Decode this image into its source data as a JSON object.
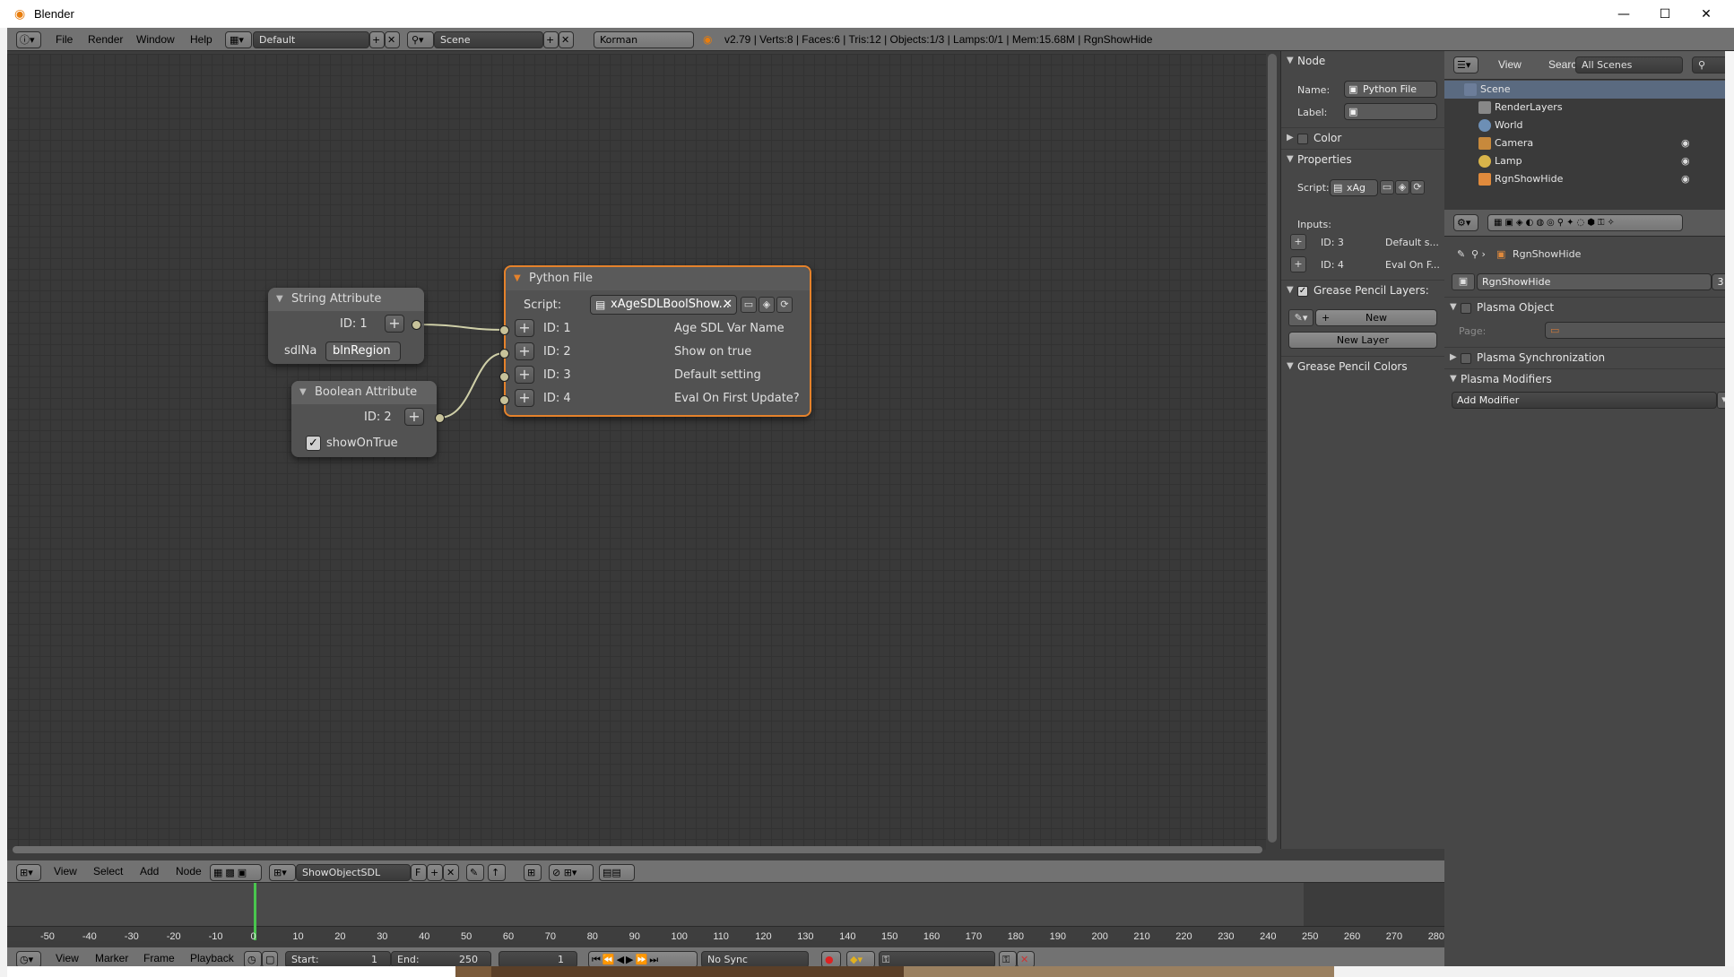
{
  "window": {
    "title": "Blender",
    "minimize": "—",
    "maximize": "☐",
    "close": "✕"
  },
  "top_header": {
    "menus": [
      "File",
      "Render",
      "Window",
      "Help"
    ],
    "layout": "Default",
    "scene": "Scene",
    "engine": "Korman",
    "info": "v2.79 | Verts:8 | Faces:6 | Tris:12 | Objects:1/3 | Lamps:0/1 | Mem:15.68M | RgnShowHide"
  },
  "nodes": {
    "string_attr": {
      "title": "String Attribute",
      "id_label": "ID: 1",
      "field_label": "sdlNa",
      "field_value": "blnRegion"
    },
    "bool_attr": {
      "title": "Boolean Attribute",
      "id_label": "ID: 2",
      "check_label": "showOnTrue"
    },
    "python_file": {
      "title": "Python File",
      "script_label": "Script:",
      "script_value": "xAgeSDLBoolShow...",
      "rows": [
        {
          "id": "ID: 1",
          "name": "Age SDL Var Name"
        },
        {
          "id": "ID: 2",
          "name": "Show on true"
        },
        {
          "id": "ID: 3",
          "name": "Default setting"
        },
        {
          "id": "ID: 4",
          "name": "Eval On First Update?"
        }
      ]
    }
  },
  "node_editor_header": {
    "menus": [
      "View",
      "Select",
      "Add",
      "Node"
    ],
    "tree_name": "ShowObjectSDL",
    "fake_user": "F"
  },
  "props_panel": {
    "node_section": "Node",
    "name_label": "Name:",
    "name_value": "Python File",
    "label_label": "Label:",
    "color_section": "Color",
    "properties_section": "Properties",
    "script_label": "Script:",
    "script_value": "xAg",
    "inputs_label": "Inputs:",
    "inputs": [
      {
        "id": "ID: 3",
        "value": "Default s..."
      },
      {
        "id": "ID: 4",
        "value": "Eval On F..."
      }
    ],
    "gp_layers_section": "Grease Pencil Layers:",
    "new_button": "New",
    "new_layer_button": "New Layer",
    "gp_colors_section": "Grease Pencil Colors"
  },
  "outliner": {
    "menus": [
      "View",
      "Search"
    ],
    "filter": "All Scenes",
    "items": [
      "Scene",
      "RenderLayers",
      "World",
      "Camera",
      "Lamp",
      "RgnShowHide"
    ]
  },
  "properties": {
    "breadcrumb": "RgnShowHide",
    "object_name": "RgnShowHide",
    "users": "3",
    "plasma_object": "Plasma Object",
    "page_label": "Page:",
    "plasma_sync": "Plasma Synchronization",
    "plasma_modifiers": "Plasma Modifiers",
    "add_modifier": "Add Modifier"
  },
  "timeline": {
    "ticks": [
      "-50",
      "-40",
      "-30",
      "-20",
      "-10",
      "0",
      "10",
      "20",
      "30",
      "40",
      "50",
      "60",
      "70",
      "80",
      "90",
      "100",
      "110",
      "120",
      "130",
      "140",
      "150",
      "160",
      "170",
      "180",
      "190",
      "200",
      "210",
      "220",
      "230",
      "240",
      "250",
      "260",
      "270",
      "280"
    ],
    "menus": [
      "View",
      "Marker",
      "Frame",
      "Playback"
    ],
    "start_label": "Start:",
    "start_value": "1",
    "end_label": "End:",
    "end_value": "250",
    "current_frame": "1",
    "sync": "No Sync",
    "playhead_frame": 0
  }
}
